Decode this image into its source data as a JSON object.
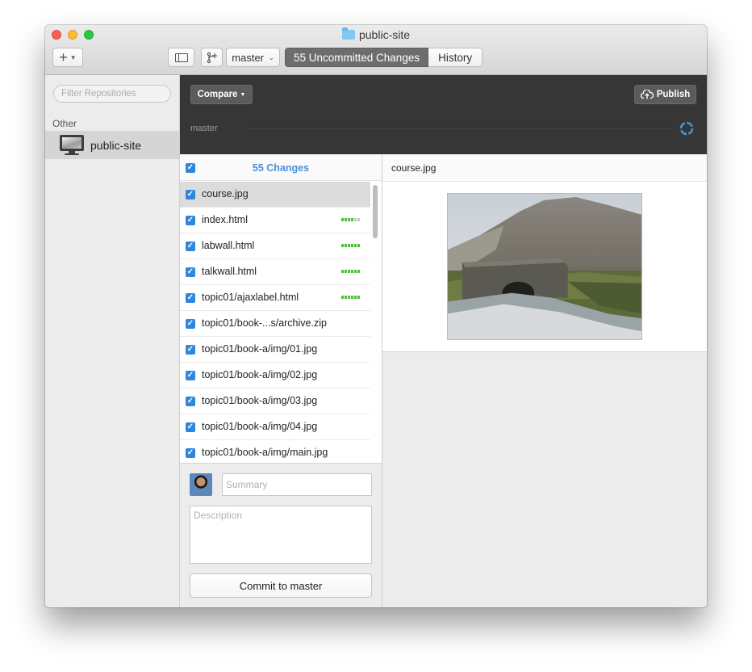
{
  "window": {
    "title": "public-site"
  },
  "toolbar": {
    "branch_selector": "master",
    "tab_changes": "55 Uncommitted Changes",
    "tab_history": "History"
  },
  "sidebar": {
    "filter_placeholder": "Filter Repositories",
    "section_label": "Other",
    "repos": [
      {
        "name": "public-site",
        "selected": true
      }
    ]
  },
  "header": {
    "compare_label": "Compare",
    "publish_label": "Publish",
    "branch_label": "master"
  },
  "changes": {
    "count_label": "55 Changes",
    "files": [
      {
        "name": "course.jpg",
        "selected": true
      },
      {
        "name": "index.html"
      },
      {
        "name": "labwall.html"
      },
      {
        "name": "talkwall.html"
      },
      {
        "name": "topic01/ajaxlabel.html"
      },
      {
        "name": "topic01/book-...s/archive.zip"
      },
      {
        "name": "topic01/book-a/img/01.jpg"
      },
      {
        "name": "topic01/book-a/img/02.jpg"
      },
      {
        "name": "topic01/book-a/img/03.jpg"
      },
      {
        "name": "topic01/book-a/img/04.jpg"
      },
      {
        "name": "topic01/book-a/img/main.jpg"
      }
    ]
  },
  "commit": {
    "summary_placeholder": "Summary",
    "description_placeholder": "Description",
    "button_label": "Commit to master"
  },
  "preview": {
    "filename": "course.jpg"
  },
  "colors": {
    "accent": "#2d88dc",
    "count_text": "#4a90d9",
    "diff_added": "#4fbf3c",
    "dark_header": "#363636",
    "active_tab": "#6d6d6d"
  }
}
